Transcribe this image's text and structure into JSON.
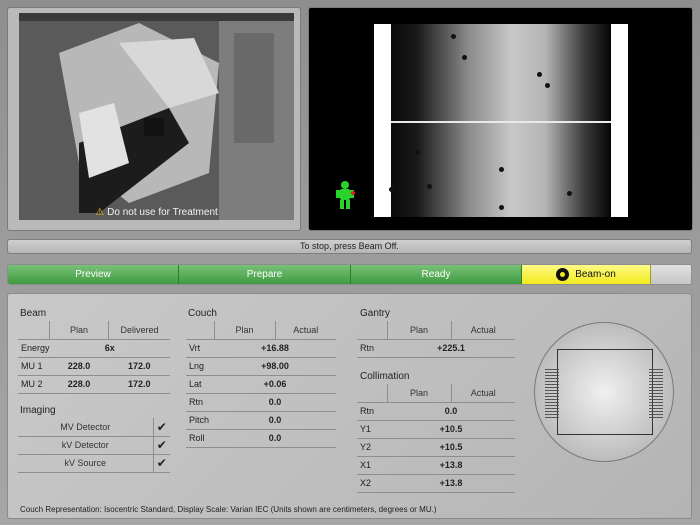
{
  "camera": {
    "warning": "Do not use for Treatment",
    "warning_icon": "warning-icon"
  },
  "status": {
    "message": "To stop, press Beam Off."
  },
  "workflow": {
    "steps": [
      "Preview",
      "Prepare",
      "Ready",
      "Beam-on"
    ],
    "active_index": 3,
    "colors": {
      "done": "#4ea84e",
      "active": "#f6ef2a"
    }
  },
  "beam": {
    "title": "Beam",
    "headers": [
      "Plan",
      "Delivered"
    ],
    "energy_label": "Energy",
    "energy_value": "6x",
    "rows": [
      {
        "label": "MU 1",
        "plan": "228.0",
        "delivered": "172.0"
      },
      {
        "label": "MU 2",
        "plan": "228.0",
        "delivered": "172.0"
      }
    ]
  },
  "imaging": {
    "title": "Imaging",
    "rows": [
      {
        "label": "MV Detector",
        "check": "✔"
      },
      {
        "label": "kV Detector",
        "check": "✔"
      },
      {
        "label": "kV Source",
        "check": "✔"
      }
    ]
  },
  "couch": {
    "title": "Couch",
    "headers": [
      "Plan",
      "Actual"
    ],
    "rows": [
      {
        "label": "Vrt",
        "value": "+16.88"
      },
      {
        "label": "Lng",
        "value": "+98.00"
      },
      {
        "label": "Lat",
        "value": "+0.06"
      },
      {
        "label": "Rtn",
        "value": "0.0"
      },
      {
        "label": "Pitch",
        "value": "0.0"
      },
      {
        "label": "Roll",
        "value": "0.0"
      }
    ]
  },
  "gantry": {
    "title": "Gantry",
    "headers": [
      "Plan",
      "Actual"
    ],
    "rows": [
      {
        "label": "Rtn",
        "value": "+225.1"
      }
    ]
  },
  "collimation": {
    "title": "Collimation",
    "headers": [
      "Plan",
      "Actual"
    ],
    "rows": [
      {
        "label": "Rtn",
        "value": "0.0"
      },
      {
        "label": "Y1",
        "value": "+10.5"
      },
      {
        "label": "Y2",
        "value": "+10.5"
      },
      {
        "label": "X1",
        "value": "+13.8"
      },
      {
        "label": "X2",
        "value": "+13.8"
      }
    ]
  },
  "footer": {
    "note": "Couch Representation: Isocentric Standard, Display Scale: Varian IEC (Units shown are centimeters, degrees or MU.)"
  }
}
